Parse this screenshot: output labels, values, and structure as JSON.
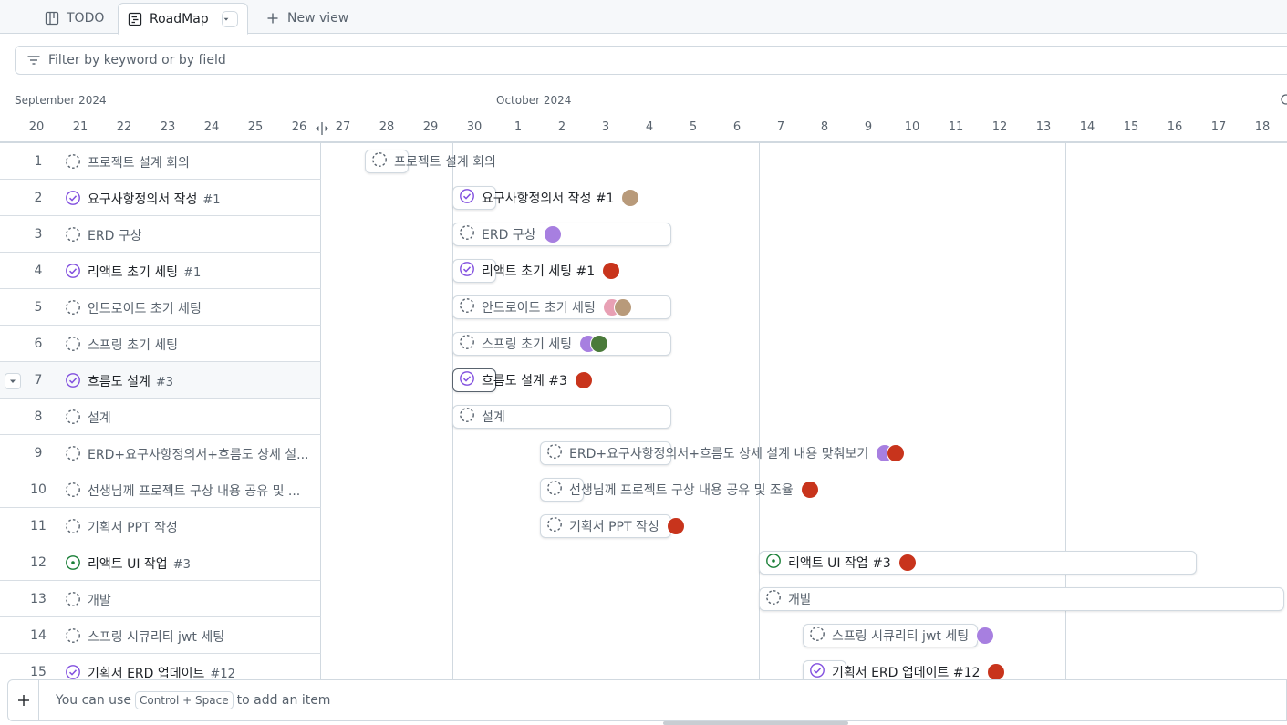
{
  "tabs": [
    {
      "label": "TODO",
      "icon": "table-icon"
    },
    {
      "label": "RoadMap",
      "icon": "roadmap-icon"
    },
    {
      "label": "New view",
      "icon": "plus-icon"
    }
  ],
  "filter": {
    "placeholder": "Filter by keyword or by field"
  },
  "timeline": {
    "months": [
      "September 2024",
      "October 2024"
    ],
    "days": [
      "20",
      "21",
      "22",
      "23",
      "24",
      "25",
      "26",
      "27",
      "28",
      "29",
      "30",
      "1",
      "2",
      "3",
      "4",
      "5",
      "6",
      "7",
      "8",
      "9",
      "10",
      "11",
      "12",
      "13",
      "14",
      "15",
      "16",
      "17",
      "18"
    ]
  },
  "items": [
    {
      "num": "1",
      "title": "프로젝트 설계 회의",
      "issue": "",
      "status": "draft",
      "bar_label": "프로젝트 설계 회의",
      "avatars": []
    },
    {
      "num": "2",
      "title": "요구사항정의서 작성",
      "issue": "#1",
      "status": "closed",
      "bar_label": "요구사항정의서 작성 #1",
      "avatars": [
        "tan"
      ]
    },
    {
      "num": "3",
      "title": "ERD 구상",
      "issue": "",
      "status": "draft",
      "bar_label": "ERD 구상",
      "avatars": [
        "purple"
      ]
    },
    {
      "num": "4",
      "title": "리액트 초기 세팅",
      "issue": "#1",
      "status": "closed",
      "bar_label": "리액트 초기 세팅 #1",
      "avatars": [
        "red"
      ]
    },
    {
      "num": "5",
      "title": "안드로이드 초기 세팅",
      "issue": "",
      "status": "draft",
      "bar_label": "안드로이드 초기 세팅",
      "avatars": [
        "pink",
        "tan"
      ]
    },
    {
      "num": "6",
      "title": "스프링 초기 세팅",
      "issue": "",
      "status": "draft",
      "bar_label": "스프링 초기 세팅",
      "avatars": [
        "purple",
        "green"
      ]
    },
    {
      "num": "7",
      "title": "흐름도 설계",
      "issue": "#3",
      "status": "closed",
      "bar_label": "흐름도 설계 #3",
      "avatars": [
        "red"
      ]
    },
    {
      "num": "8",
      "title": "설계",
      "issue": "",
      "status": "draft",
      "bar_label": "설계",
      "avatars": []
    },
    {
      "num": "9",
      "title": "ERD+요구사항정의서+흐름도 상세 설...",
      "issue": "",
      "status": "draft",
      "bar_label": "ERD+요구사항정의서+흐름도 상세 설계 내용 맞춰보기",
      "avatars": [
        "purple",
        "red"
      ]
    },
    {
      "num": "10",
      "title": "선생님께 프로젝트 구상 내용 공유 및 ...",
      "issue": "",
      "status": "draft",
      "bar_label": "선생님께 프로젝트 구상 내용 공유 및 조율",
      "avatars": [
        "red"
      ]
    },
    {
      "num": "11",
      "title": "기획서 PPT 작성",
      "issue": "",
      "status": "draft",
      "bar_label": "기획서 PPT 작성",
      "avatars": [
        "red"
      ]
    },
    {
      "num": "12",
      "title": "리액트 UI 작업",
      "issue": "#3",
      "status": "open",
      "bar_label": "리액트 UI 작업 #3",
      "avatars": [
        "red"
      ]
    },
    {
      "num": "13",
      "title": "개발",
      "issue": "",
      "status": "draft",
      "bar_label": "개발",
      "avatars": []
    },
    {
      "num": "14",
      "title": "스프링 시큐리티 jwt 세팅",
      "issue": "",
      "status": "draft",
      "bar_label": "스프링 시큐리티 jwt 세팅",
      "avatars": [
        "purple"
      ]
    },
    {
      "num": "15",
      "title": "기획서 ERD 업데이트",
      "issue": "#12",
      "status": "closed",
      "bar_label": "기획서 ERD 업데이트 #12",
      "avatars": [
        "red"
      ]
    }
  ],
  "footer": {
    "prefix": "You can use",
    "shortcut": "Control + Space",
    "suffix": "to add an item"
  },
  "colors": {
    "closed": "#8250df",
    "open": "#1a7f37",
    "draft": "#59636e",
    "border": "#d1d9e0"
  }
}
